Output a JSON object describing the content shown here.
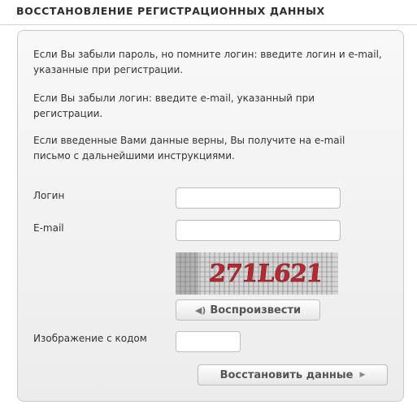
{
  "page": {
    "title": "ВОССТАНОВЛЕНИЕ РЕГИСТРАЦИОННЫХ ДАННЫХ"
  },
  "instructions": [
    "Если Вы забыли пароль, но помните логин: введите логин и e-mail, указанные при регистрации.",
    "Если Вы забыли логин: введите e-mail, указанный при регистрации.",
    "Если введенные Вами данные верны, Вы получите на e-mail письмо с дальнейшими инструкциями."
  ],
  "form": {
    "login_label": "Логин",
    "login_value": "",
    "email_label": "E-mail",
    "email_value": "",
    "captcha_text": "271L621",
    "play_label": "Воспроизвести",
    "play_icon": "speaker-icon",
    "code_label": "Изображение с кодом",
    "code_value": "",
    "submit_label": "Восстановить данные",
    "submit_icon": "arrow-right-icon"
  },
  "colors": {
    "panel_border": "#c9c9c9",
    "captcha_text": "#b52a32"
  }
}
